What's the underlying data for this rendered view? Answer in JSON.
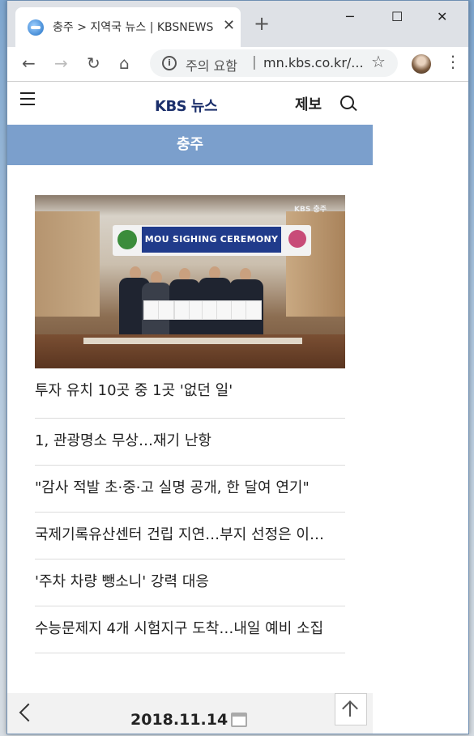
{
  "browser": {
    "tab_title": "충주 > 지역국 뉴스 | KBSNEWS",
    "tab_close": "✕",
    "new_tab": "+",
    "omnibox_warning": "주의 요함",
    "omnibox_separator": "|",
    "url": "mn.kbs.co.kr/...",
    "window_controls": {
      "minimize": "─",
      "maximize": "☐",
      "close": "✕"
    }
  },
  "site": {
    "logo": "KBS 뉴스",
    "report_label": "제보",
    "region": "충주"
  },
  "hero": {
    "banner_title": "MOU SIGHING CEREMONY",
    "brand_watermark": "KBS 충주",
    "headline": "투자 유치 10곳 중 1곳 '없던 일'"
  },
  "articles": [
    "1, 관광명소 무상…재기 난항",
    "\"감사 적발 초·중·고 실명 공개, 한 달여 연기\"",
    "국제기록유산센터 건립 지연…부지 선정은 이…",
    "'주차 차량 뺑소니' 강력 대응",
    "수능문제지 4개 시험지구 도착…내일 예비 소집"
  ],
  "footer": {
    "date": "2018.11.14"
  },
  "icons": {
    "back": "back-arrow-icon",
    "forward": "forward-arrow-icon",
    "reload": "reload-icon",
    "home": "home-icon",
    "info": "info-icon",
    "bookmark": "star-icon",
    "menu": "hamburger-icon",
    "search": "search-icon",
    "calendar": "calendar-icon",
    "scroll_top": "scroll-top-icon"
  },
  "colors": {
    "region_bar": "#7b9fcc",
    "logo": "#1b2f6b"
  }
}
